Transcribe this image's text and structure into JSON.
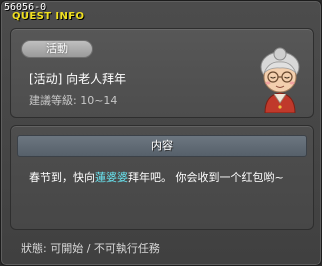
{
  "window": {
    "id": "56056-0",
    "title": "QUEST INFO"
  },
  "quest": {
    "category": "活動",
    "name": "[活动] 向老人拜年",
    "level": "建議等級: 10~14",
    "npc_portrait": "old-woman-npc"
  },
  "content": {
    "header": "内容",
    "text_before": "春节到，快向",
    "npc_name": "蓮婆婆",
    "text_after": "拜年吧。 你会收到一个红包哟~"
  },
  "status": {
    "text": "狀態: 可開始 / 不可執行任務"
  },
  "colors": {
    "title": "#f0e020",
    "npc_link": "#69e4f0",
    "panel": "#4d4d4d"
  }
}
